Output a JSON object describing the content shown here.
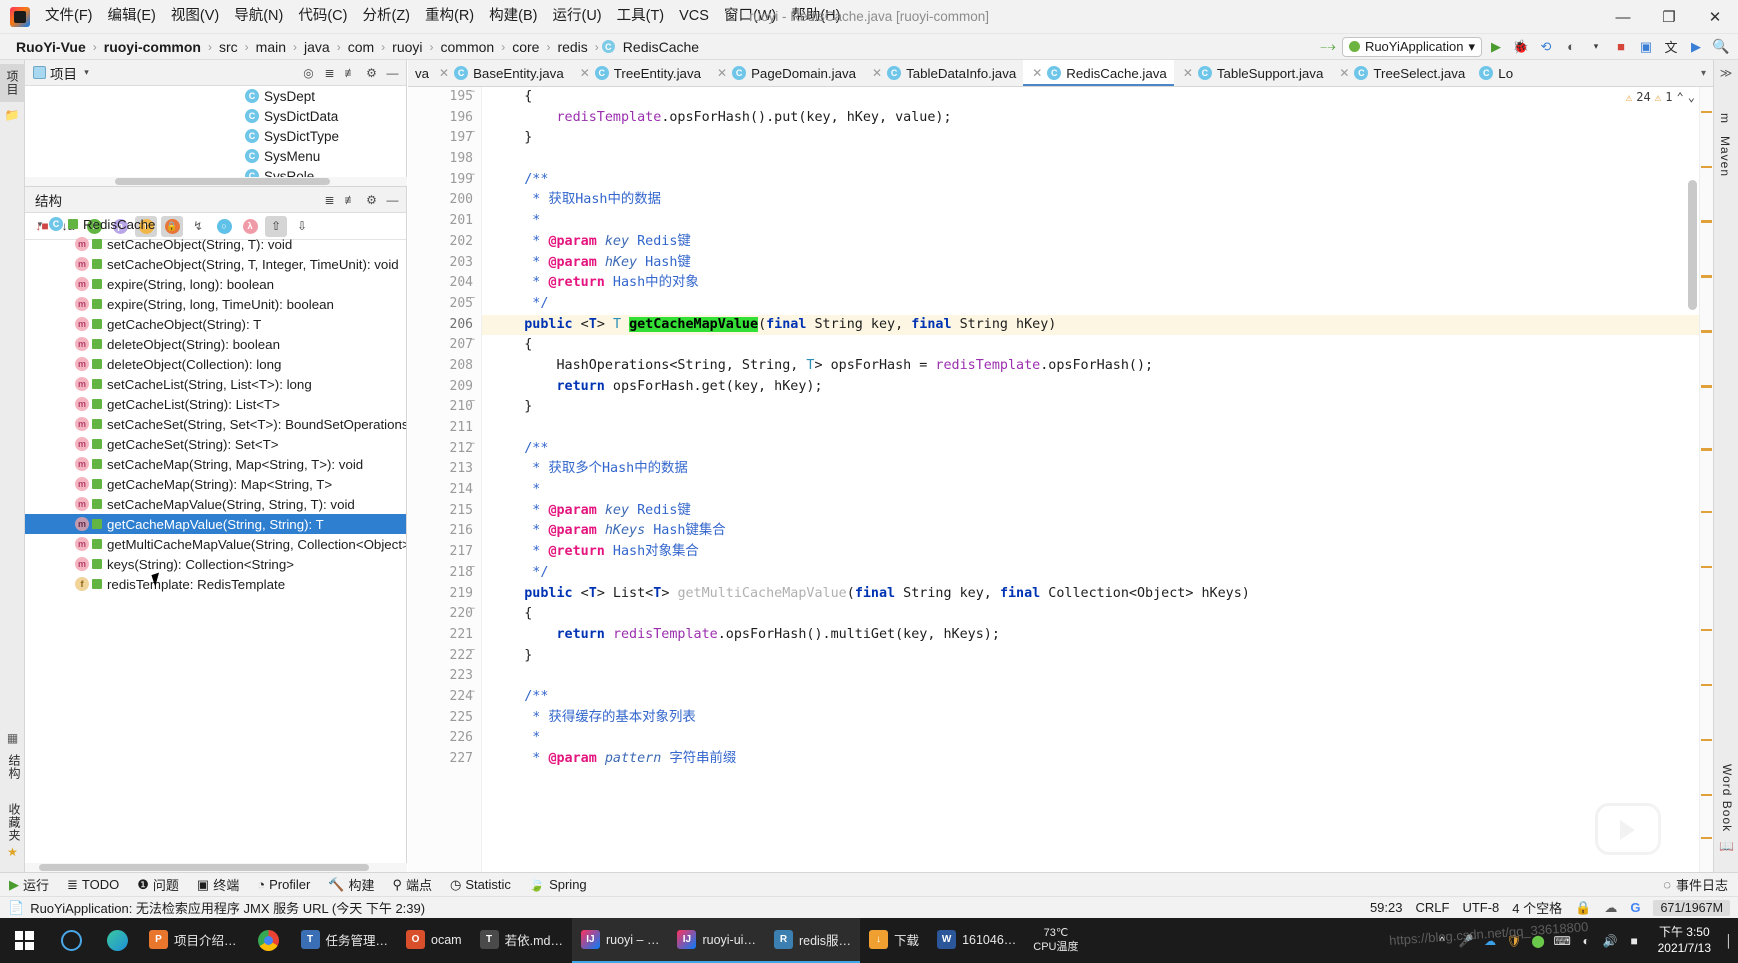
{
  "titlebar": {
    "menu": [
      "文件(F)",
      "编辑(E)",
      "视图(V)",
      "导航(N)",
      "代码(C)",
      "分析(Z)",
      "重构(R)",
      "构建(B)",
      "运行(U)",
      "工具(T)",
      "VCS",
      "窗口(W)",
      "帮助(H)"
    ],
    "window_title": "ruoyi - RedisCache.java [ruoyi-common]",
    "minimize": "—",
    "maximize": "❐",
    "close": "✕"
  },
  "navbar": {
    "breadcrumbs": [
      "RuoYi-Vue",
      "ruoyi-common",
      "src",
      "main",
      "java",
      "com",
      "ruoyi",
      "common",
      "core",
      "redis",
      "RedisCache"
    ],
    "run_config": "RuoYiApplication",
    "dropdown_caret": "▾"
  },
  "project_panel": {
    "title": "项目",
    "caret": "▾",
    "items": [
      "SysDept",
      "SysDictData",
      "SysDictType",
      "SysMenu",
      "SysRole"
    ]
  },
  "structure_panel": {
    "title": "结构",
    "root": "RedisCache",
    "members": [
      {
        "kind": "m",
        "label": "setCacheObject(String, T): void"
      },
      {
        "kind": "m",
        "label": "setCacheObject(String, T, Integer, TimeUnit): void"
      },
      {
        "kind": "m",
        "label": "expire(String, long): boolean"
      },
      {
        "kind": "m",
        "label": "expire(String, long, TimeUnit): boolean"
      },
      {
        "kind": "m",
        "label": "getCacheObject(String): T"
      },
      {
        "kind": "m",
        "label": "deleteObject(String): boolean"
      },
      {
        "kind": "m",
        "label": "deleteObject(Collection): long"
      },
      {
        "kind": "m",
        "label": "setCacheList(String, List<T>): long"
      },
      {
        "kind": "m",
        "label": "getCacheList(String): List<T>"
      },
      {
        "kind": "m",
        "label": "setCacheSet(String, Set<T>): BoundSetOperations"
      },
      {
        "kind": "m",
        "label": "getCacheSet(String): Set<T>"
      },
      {
        "kind": "m",
        "label": "setCacheMap(String, Map<String, T>): void"
      },
      {
        "kind": "m",
        "label": "getCacheMap(String): Map<String, T>"
      },
      {
        "kind": "m",
        "label": "setCacheMapValue(String, String, T): void"
      },
      {
        "kind": "m",
        "label": "getCacheMapValue(String, String): T",
        "selected": true
      },
      {
        "kind": "m",
        "label": "getMultiCacheMapValue(String, Collection<Object>"
      },
      {
        "kind": "m",
        "label": "keys(String): Collection<String>"
      },
      {
        "kind": "f",
        "label": "redisTemplate: RedisTemplate"
      }
    ]
  },
  "editor": {
    "tabs": [
      {
        "label": "va",
        "partial": true
      },
      {
        "label": "BaseEntity.java"
      },
      {
        "label": "TreeEntity.java"
      },
      {
        "label": "PageDomain.java"
      },
      {
        "label": "TableDataInfo.java"
      },
      {
        "label": "RedisCache.java",
        "active": true
      },
      {
        "label": "TableSupport.java"
      },
      {
        "label": "TreeSelect.java"
      },
      {
        "label": "Lo",
        "partial": true
      }
    ],
    "inspection": {
      "warnings": "24",
      "weak": "1",
      "up": "⌃",
      "down": "⌄"
    },
    "first_line": 195,
    "current_line": 206,
    "lines": [
      {
        "n": 195,
        "fold": "−",
        "tokens": [
          {
            "t": "    {",
            "c": "mtd"
          }
        ]
      },
      {
        "n": 196,
        "tokens": [
          {
            "t": "        ",
            "c": "mtd"
          },
          {
            "t": "redisTemplate",
            "c": "fld"
          },
          {
            "t": ".opsForHash().put(key, hKey, value);",
            "c": "mtd"
          }
        ]
      },
      {
        "n": 197,
        "fold": "⌐",
        "tokens": [
          {
            "t": "    }",
            "c": "mtd"
          }
        ]
      },
      {
        "n": 198,
        "tokens": [
          {
            "t": "",
            "c": "mtd"
          }
        ]
      },
      {
        "n": 199,
        "fold": "−",
        "tokens": [
          {
            "t": "    /**",
            "c": "jdoc"
          }
        ]
      },
      {
        "n": 200,
        "tokens": [
          {
            "t": "     * 获取Hash中的数据",
            "c": "jdoc"
          }
        ]
      },
      {
        "n": 201,
        "tokens": [
          {
            "t": "     *",
            "c": "jdoc"
          }
        ]
      },
      {
        "n": 202,
        "tokens": [
          {
            "t": "     * ",
            "c": "jdoc"
          },
          {
            "t": "@param",
            "c": "jtag"
          },
          {
            "t": " key",
            "c": "jparam"
          },
          {
            "t": " Redis键",
            "c": "jdoc"
          }
        ]
      },
      {
        "n": 203,
        "tokens": [
          {
            "t": "     * ",
            "c": "jdoc"
          },
          {
            "t": "@param",
            "c": "jtag"
          },
          {
            "t": " hKey",
            "c": "jparam"
          },
          {
            "t": " Hash键",
            "c": "jdoc"
          }
        ]
      },
      {
        "n": 204,
        "tokens": [
          {
            "t": "     * ",
            "c": "jdoc"
          },
          {
            "t": "@return",
            "c": "jtag"
          },
          {
            "t": " Hash中的对象",
            "c": "jdoc"
          }
        ]
      },
      {
        "n": 205,
        "fold": "⌐",
        "tokens": [
          {
            "t": "     */",
            "c": "jdoc"
          }
        ]
      },
      {
        "n": 206,
        "hl": true,
        "tokens": [
          {
            "t": "    ",
            "c": "mtd"
          },
          {
            "t": "public",
            "c": "kw"
          },
          {
            "t": " <",
            "c": "mtd"
          },
          {
            "t": "T",
            "c": "kw"
          },
          {
            "t": "> ",
            "c": "mtd"
          },
          {
            "t": "T",
            "c": "gen"
          },
          {
            "t": " ",
            "c": "mtd"
          },
          {
            "t": "getCacheMapValue",
            "c": "hlname"
          },
          {
            "t": "(",
            "c": "mtd"
          },
          {
            "t": "final",
            "c": "kw"
          },
          {
            "t": " String key, ",
            "c": "mtd"
          },
          {
            "t": "final",
            "c": "kw"
          },
          {
            "t": " String hKey)",
            "c": "mtd"
          }
        ]
      },
      {
        "n": 207,
        "fold": "−",
        "tokens": [
          {
            "t": "    {",
            "c": "mtd"
          }
        ]
      },
      {
        "n": 208,
        "tokens": [
          {
            "t": "        HashOperations<String, String, ",
            "c": "mtd"
          },
          {
            "t": "T",
            "c": "gen"
          },
          {
            "t": "> opsForHash = ",
            "c": "mtd"
          },
          {
            "t": "redisTemplate",
            "c": "fld"
          },
          {
            "t": ".opsForHash();",
            "c": "mtd"
          }
        ]
      },
      {
        "n": 209,
        "tokens": [
          {
            "t": "        ",
            "c": "mtd"
          },
          {
            "t": "return",
            "c": "kw"
          },
          {
            "t": " opsForHash.get(key, hKey);",
            "c": "mtd"
          }
        ]
      },
      {
        "n": 210,
        "fold": "⌐",
        "tokens": [
          {
            "t": "    }",
            "c": "mtd"
          }
        ]
      },
      {
        "n": 211,
        "tokens": [
          {
            "t": "",
            "c": "mtd"
          }
        ]
      },
      {
        "n": 212,
        "fold": "−",
        "tokens": [
          {
            "t": "    /**",
            "c": "jdoc"
          }
        ]
      },
      {
        "n": 213,
        "tokens": [
          {
            "t": "     * 获取多个Hash中的数据",
            "c": "jdoc"
          }
        ]
      },
      {
        "n": 214,
        "tokens": [
          {
            "t": "     *",
            "c": "jdoc"
          }
        ]
      },
      {
        "n": 215,
        "tokens": [
          {
            "t": "     * ",
            "c": "jdoc"
          },
          {
            "t": "@param",
            "c": "jtag"
          },
          {
            "t": " key",
            "c": "jparam"
          },
          {
            "t": " Redis键",
            "c": "jdoc"
          }
        ]
      },
      {
        "n": 216,
        "tokens": [
          {
            "t": "     * ",
            "c": "jdoc"
          },
          {
            "t": "@param",
            "c": "jtag"
          },
          {
            "t": " hKeys",
            "c": "jparam"
          },
          {
            "t": " Hash键集合",
            "c": "jdoc"
          }
        ]
      },
      {
        "n": 217,
        "tokens": [
          {
            "t": "     * ",
            "c": "jdoc"
          },
          {
            "t": "@return",
            "c": "jtag"
          },
          {
            "t": " Hash对象集合",
            "c": "jdoc"
          }
        ]
      },
      {
        "n": 218,
        "fold": "⌐",
        "tokens": [
          {
            "t": "     */",
            "c": "jdoc"
          }
        ]
      },
      {
        "n": 219,
        "tokens": [
          {
            "t": "    ",
            "c": "mtd"
          },
          {
            "t": "public",
            "c": "kw"
          },
          {
            "t": " <",
            "c": "mtd"
          },
          {
            "t": "T",
            "c": "kw"
          },
          {
            "t": "> List<",
            "c": "mtd"
          },
          {
            "t": "T",
            "c": "kw"
          },
          {
            "t": "> ",
            "c": "mtd"
          },
          {
            "t": "getMultiCacheMapValue",
            "c": "dim"
          },
          {
            "t": "(",
            "c": "mtd"
          },
          {
            "t": "final",
            "c": "kw"
          },
          {
            "t": " String key, ",
            "c": "mtd"
          },
          {
            "t": "final",
            "c": "kw"
          },
          {
            "t": " Collection<Object> hKeys)",
            "c": "mtd"
          }
        ]
      },
      {
        "n": 220,
        "fold": "−",
        "tokens": [
          {
            "t": "    {",
            "c": "mtd"
          }
        ]
      },
      {
        "n": 221,
        "tokens": [
          {
            "t": "        ",
            "c": "mtd"
          },
          {
            "t": "return",
            "c": "kw"
          },
          {
            "t": " ",
            "c": "mtd"
          },
          {
            "t": "redisTemplate",
            "c": "fld"
          },
          {
            "t": ".opsForHash().multiGet(key, hKeys);",
            "c": "mtd"
          }
        ]
      },
      {
        "n": 222,
        "fold": "⌐",
        "tokens": [
          {
            "t": "    }",
            "c": "mtd"
          }
        ]
      },
      {
        "n": 223,
        "tokens": [
          {
            "t": "",
            "c": "mtd"
          }
        ]
      },
      {
        "n": 224,
        "fold": "−",
        "tokens": [
          {
            "t": "    /**",
            "c": "jdoc"
          }
        ]
      },
      {
        "n": 225,
        "tokens": [
          {
            "t": "     * 获得缓存的基本对象列表",
            "c": "jdoc"
          }
        ]
      },
      {
        "n": 226,
        "tokens": [
          {
            "t": "     *",
            "c": "jdoc"
          }
        ]
      },
      {
        "n": 227,
        "tokens": [
          {
            "t": "     * ",
            "c": "jdoc"
          },
          {
            "t": "@param",
            "c": "jtag"
          },
          {
            "t": " pattern",
            "c": "jparam"
          },
          {
            "t": " 字符串前缀",
            "c": "jdoc"
          }
        ]
      }
    ]
  },
  "left_strip": {
    "tabs": [
      "项目"
    ]
  },
  "right_strip": {
    "tabs": [
      "m",
      "Maven",
      "Word Book"
    ]
  },
  "left_strip_bottom": {
    "tabs": [
      "结构",
      "收藏夹"
    ]
  },
  "bottom_toolwindows": [
    {
      "icon": "▶",
      "label": "运行"
    },
    {
      "icon": "≣",
      "label": "TODO"
    },
    {
      "icon": "❶",
      "label": "问题"
    },
    {
      "icon": "▣",
      "label": "终端"
    },
    {
      "icon": "◔",
      "label": "Profiler"
    },
    {
      "icon": "🔨",
      "label": "构建"
    },
    {
      "icon": "⚲",
      "label": "端点"
    },
    {
      "icon": "◷",
      "label": "Statistic"
    },
    {
      "icon": "🍃",
      "label": "Spring"
    }
  ],
  "bottom_right": {
    "label": "事件日志",
    "icon": "◌"
  },
  "statusbar": {
    "message": "RuoYiApplication: 无法检索应用程序 JMX 服务 URL (今天 下午 2:39)",
    "caret": "59:23",
    "line_sep": "CRLF",
    "encoding": "UTF-8",
    "indent": "4 个空格",
    "memory": "671/1967M"
  },
  "taskbar": {
    "apps": [
      {
        "label": "项目介绍…",
        "color": "#e8762d",
        "letter": "P",
        "open": false
      },
      {
        "label": "任务管理…",
        "color": "#3a6fb5",
        "letter": "T",
        "open": false
      },
      {
        "label": "ocam",
        "color": "#d94f2b",
        "letter": "O",
        "open": false
      },
      {
        "label": "若依.md…",
        "color": "#4a4a4a",
        "letter": "T",
        "open": false
      },
      {
        "label": "ruoyi – …",
        "color": "#d34b3a",
        "letter": "IJ",
        "open": true
      },
      {
        "label": "ruoyi-ui…",
        "color": "#d34b3a",
        "letter": "IJ",
        "open": true
      },
      {
        "label": "redis服…",
        "color": "#3c7fb1",
        "letter": "R",
        "open": true
      },
      {
        "label": "下载",
        "color": "#f0a030",
        "letter": "↓",
        "open": false
      },
      {
        "label": "161046…",
        "color": "#2b579a",
        "letter": "W",
        "open": false
      }
    ],
    "temperature": "73℃",
    "temperature_label": "CPU温度",
    "clock_time": "下午 3:50",
    "clock_date": "2021/7/13",
    "tray_expand": "^"
  },
  "watermark": "https://blog.csdn.net/qq_33618800",
  "colors": {
    "accent": "#2f7fd1",
    "highlight_green": "#34e035",
    "current_line": "#fdf6e3",
    "taskbar": "#1b1b1b"
  }
}
